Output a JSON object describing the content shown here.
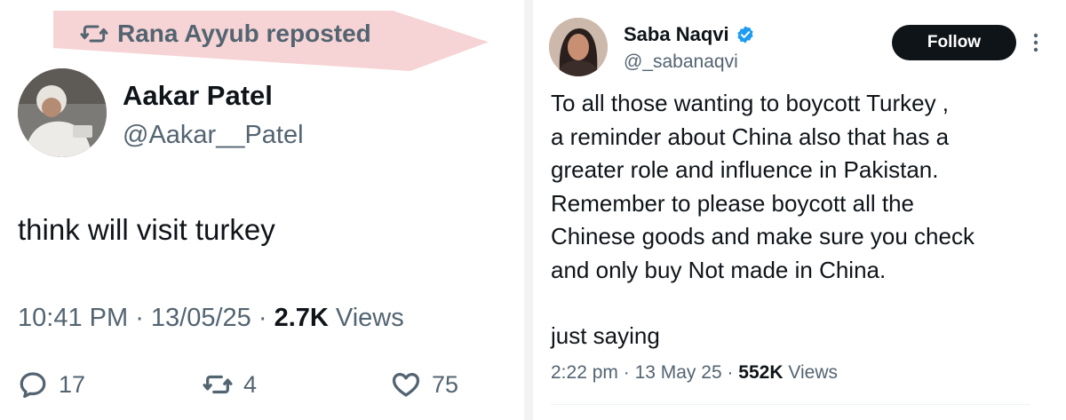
{
  "left_tweet": {
    "repost_label": "Rana Ayyub reposted",
    "author_name": "Aakar Patel",
    "author_handle": "@Aakar__Patel",
    "text": "think will visit turkey",
    "time": "10:41 PM",
    "date": "13/05/25",
    "views_count": "2.7K",
    "views_label": "Views",
    "replies": "17",
    "reposts": "4",
    "likes": "75"
  },
  "right_tweet": {
    "author_name": "Saba Naqvi",
    "author_handle": "@_sabanaqvi",
    "follow_label": "Follow",
    "text_lines": [
      "To all those wanting to boycott Turkey ,",
      "a reminder about China also that has a",
      "greater role and influence in Pakistan.",
      "Remember to please boycott all the",
      "Chinese goods and make sure you check",
      "and only buy Not made in China."
    ],
    "text_footer": "just saying",
    "time": "2:22 pm",
    "date": "13 May 25",
    "views_count": "552K",
    "views_label": "Views"
  },
  "colors": {
    "text_primary": "#0f1419",
    "text_secondary": "#536471",
    "verified": "#1d9bf0",
    "repost_highlight": "#f6d4d6",
    "follow_button": "#0f1419"
  },
  "icons": [
    "repost-icon",
    "reply-icon",
    "like-icon",
    "verified-icon",
    "more-icon"
  ]
}
